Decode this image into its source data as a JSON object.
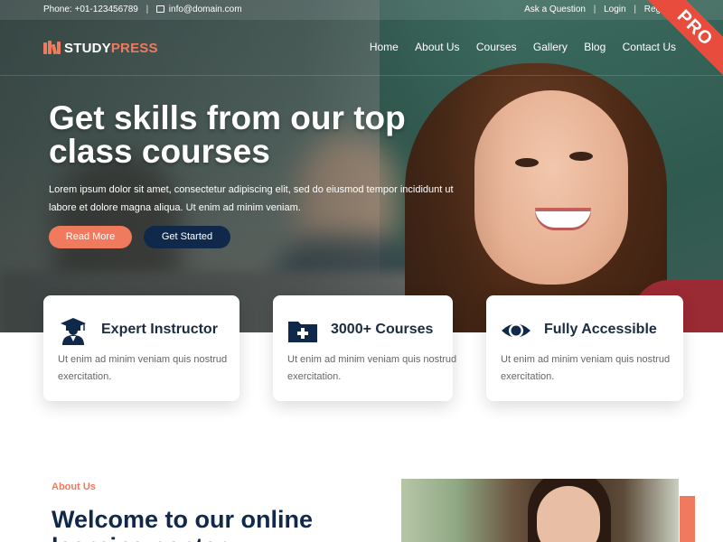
{
  "topbar": {
    "phone": "Phone: +01-123456789",
    "email": "info@domain.com",
    "links": [
      "Ask a Question",
      "Login",
      "Register"
    ]
  },
  "brand": {
    "logo_part1": "STUDY",
    "logo_part2": "PRESS"
  },
  "nav": [
    "Home",
    "About Us",
    "Courses",
    "Gallery",
    "Blog",
    "Contact Us"
  ],
  "ribbon": "PRO",
  "hero": {
    "title": "Get skills from our top class courses",
    "description": "Lorem ipsum dolor sit amet, consectetur adipiscing elit, sed do eiusmod tempor incididunt ut labore et dolore magna aliqua. Ut enim ad minim veniam.",
    "btn_read": "Read More",
    "btn_start": "Get Started"
  },
  "features": [
    {
      "icon": "graduate-icon",
      "title": "Expert Instructor",
      "text": "Ut enim ad minim veniam quis nostrud exercitation."
    },
    {
      "icon": "folder-plus-icon",
      "title": "3000+ Courses",
      "text": "Ut enim ad minim veniam quis nostrud exercitation."
    },
    {
      "icon": "eye-icon",
      "title": "Fully Accessible",
      "text": "Ut enim ad minim veniam quis nostrud exercitation."
    }
  ],
  "about": {
    "label": "About Us",
    "title": "Welcome to our online learning center"
  },
  "colors": {
    "accent": "#f07a5e",
    "navy": "#10294a",
    "ribbon": "#e84c3d"
  }
}
